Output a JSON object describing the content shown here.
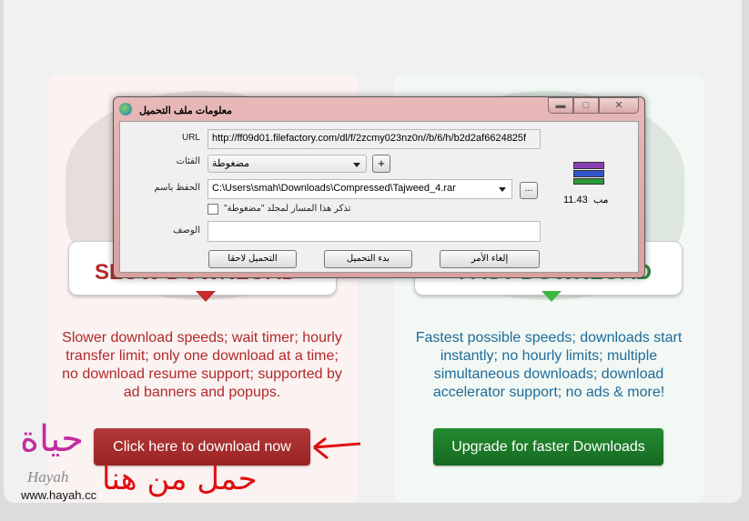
{
  "free": {
    "description": "Slower download speeds; wait timer; hourly transfer limit; only one download at a time; no download resume support; supported by ad banners and popups.",
    "button": "Click here to download now",
    "badge_text": "SLOW DOWNLOAD",
    "color": "#a42a2a"
  },
  "premium": {
    "description": "Fastest possible speeds; downloads start instantly; no hourly limits; multiple simultaneous downloads; download accelerator support; no ads & more!",
    "button": "Upgrade for faster Downloads",
    "badge_text": "FAST DOWNLOAD",
    "color": "#1d7a2a"
  },
  "dialog": {
    "title": "معلومات ملف التحميل",
    "url_label": "URL",
    "url": "http://ff09d01.filefactory.com/dl/f/2zcmy023nz0n//b/6/h/b2d2af6624825f",
    "category_label": "الفئات",
    "category": "مضغوطة",
    "add_label": "+",
    "saveas_label": "الحفظ باسم",
    "saveas": "C:\\Users\\smah\\Downloads\\Compressed\\Tajweed_4.rar",
    "browse_label": "...",
    "remember_label": "تذكر هذا المسار لمجلد \"مضغوطة\"",
    "remember_checked": false,
    "description_label": "الوصف",
    "description": "",
    "size": "11.43",
    "size_unit": "مب",
    "file_icon": "winrar-archive-icon",
    "buttons": {
      "later": "التحميل لاحقا",
      "start": "بدء التحميل",
      "cancel": "إلغاء الأمر"
    }
  },
  "watermark": {
    "logo": "حياة Hayah",
    "site": "www.hayah.cc",
    "handwritten": "حمل من هنا"
  }
}
